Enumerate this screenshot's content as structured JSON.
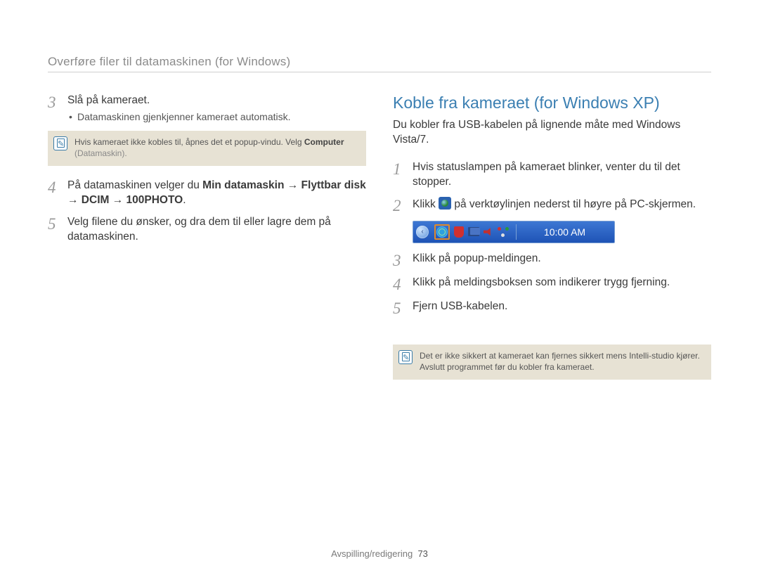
{
  "breadcrumb": "Overføre filer til datamaskinen (for Windows)",
  "left": {
    "step3": {
      "num": "3",
      "text": "Slå på kameraet.",
      "bullet": "Datamaskinen gjenkjenner kameraet automatisk."
    },
    "note1": {
      "pre": "Hvis kameraet ikke kobles til, åpnes det et popup-vindu. Velg ",
      "bold": "Computer",
      "paren": " (Datamaskin)."
    },
    "step4": {
      "num": "4",
      "pre": "På datamaskinen velger du ",
      "bold": "Min datamaskin → Flyttbar disk → DCIM → 100PHOTO",
      "post": "."
    },
    "step5": {
      "num": "5",
      "text": "Velg filene du ønsker, og dra dem til eller lagre dem på datamaskinen."
    }
  },
  "right": {
    "title": "Koble fra kameraet (for Windows XP)",
    "intro": "Du kobler fra USB-kabelen på lignende måte med Windows Vista/7.",
    "step1": {
      "num": "1",
      "text": "Hvis statuslampen på kameraet blinker, venter du til det stopper."
    },
    "step2": {
      "num": "2",
      "pre": "Klikk ",
      "post": " på verktøylinjen nederst til høyre på PC-skjermen."
    },
    "taskbar": {
      "time": "10:00 AM"
    },
    "step3": {
      "num": "3",
      "text": "Klikk på popup-meldingen."
    },
    "step4": {
      "num": "4",
      "text": "Klikk på meldingsboksen som indikerer trygg fjerning."
    },
    "step5": {
      "num": "5",
      "text": "Fjern USB-kabelen."
    },
    "note2": "Det er ikke sikkert at kameraet kan fjernes sikkert mens Intelli-studio kjører. Avslutt programmet før du kobler fra kameraet."
  },
  "footer": {
    "section": "Avspilling/redigering",
    "page": "73"
  }
}
